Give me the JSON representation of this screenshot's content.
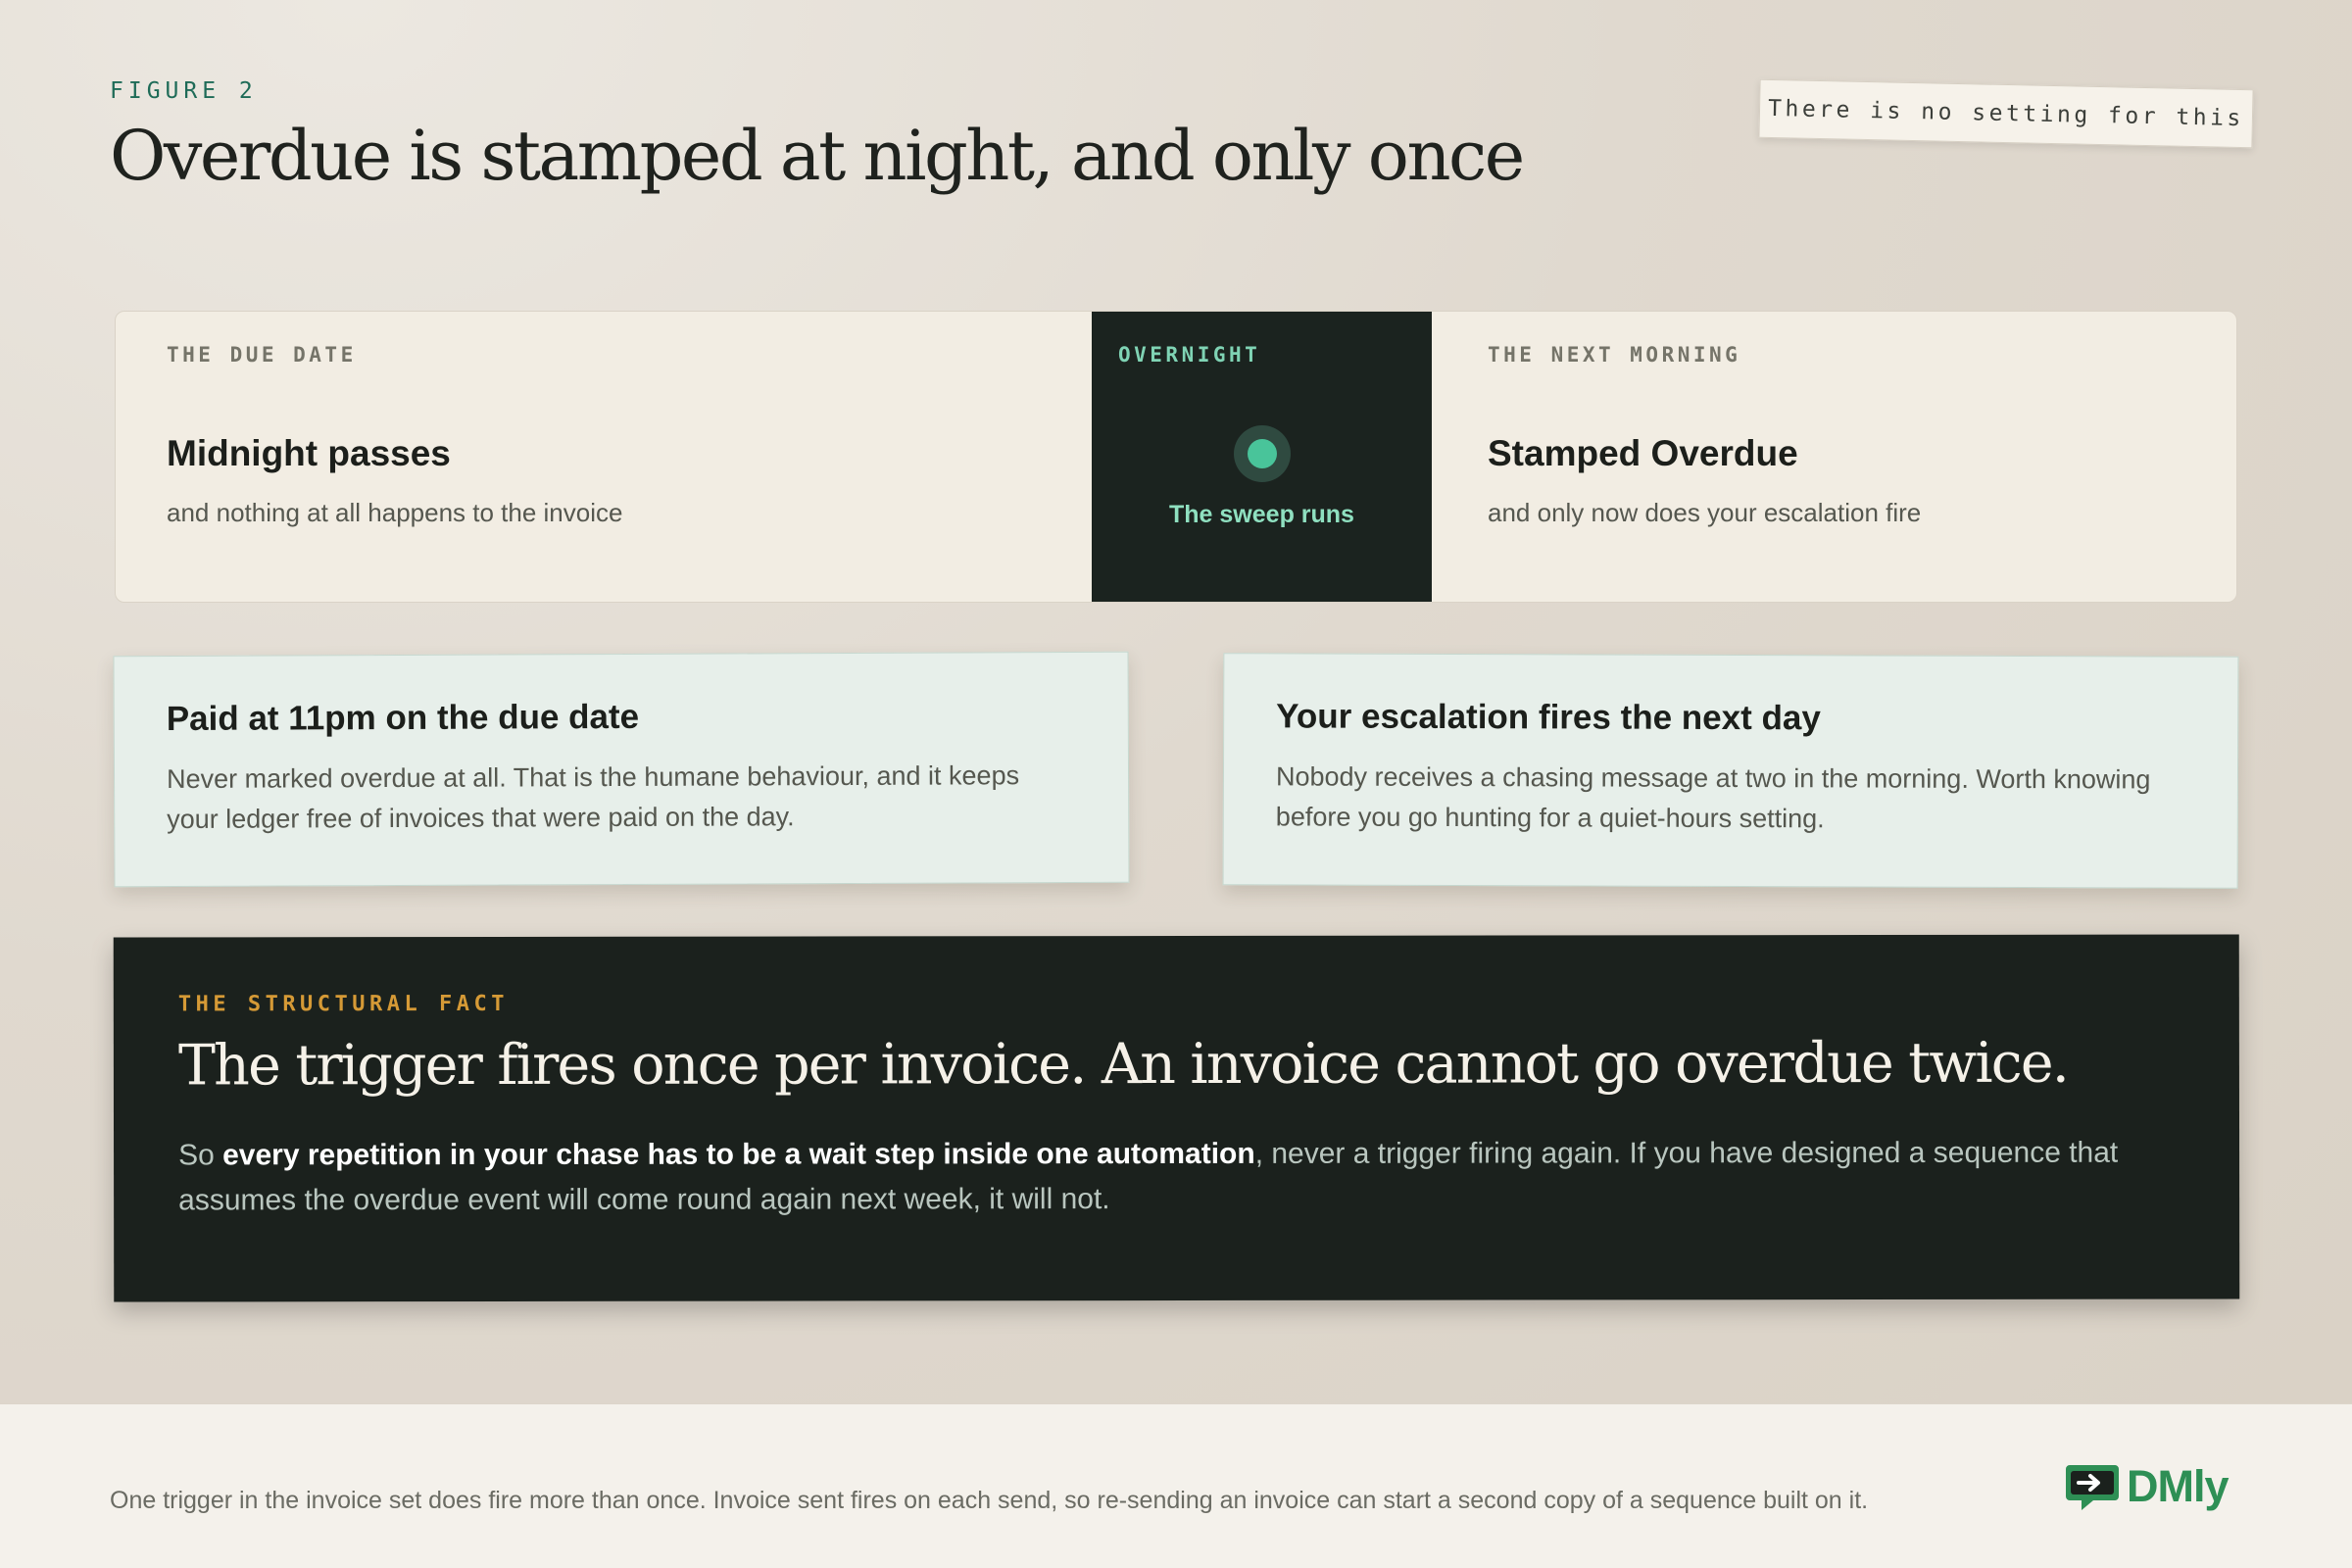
{
  "header": {
    "figure_label": "FIGURE 2",
    "title": "Overdue is stamped at night, and only once",
    "stamp_note": "There is no setting for this"
  },
  "timeline": {
    "due_date": {
      "kicker": "THE DUE DATE",
      "title": "Midnight passes",
      "subtitle": "and nothing at all happens to the invoice"
    },
    "overnight": {
      "kicker": "OVERNIGHT",
      "label": "The sweep runs"
    },
    "next_morning": {
      "kicker": "THE NEXT MORNING",
      "title": "Stamped Overdue",
      "subtitle": "and only now does your escalation fire"
    }
  },
  "notes": [
    {
      "title": "Paid at 11pm on the due date",
      "body": "Never marked overdue at all. That is the humane behaviour, and it keeps your ledger free of invoices that were paid on the day."
    },
    {
      "title": "Your escalation fires the next day",
      "body": "Nobody receives a chasing message at two in the morning. Worth knowing before you go hunting for a quiet-hours setting."
    }
  ],
  "fact": {
    "kicker": "THE STRUCTURAL FACT",
    "headline": "The trigger fires once per invoice. An invoice cannot go overdue twice.",
    "body_prefix": "So ",
    "body_emphasis": "every repetition in your chase has to be a wait step inside one automation",
    "body_suffix": ", never a trigger firing again. If you have designed a sequence that assumes the overdue event will come round again next week, it will not."
  },
  "footer": {
    "note": "One trigger in the invoice set does fire more than once. Invoice sent fires on each send, so re-sending an invoice can start a second copy of a sequence built on it.",
    "logo_text": "DMly",
    "logo_icon": "chat-arrow-icon"
  },
  "colors": {
    "accent_green": "#1e6b57",
    "mint": "#8fe0c0",
    "amber": "#d69a36",
    "brand_green": "#2e8f55",
    "dark_panel": "#1b211d"
  }
}
